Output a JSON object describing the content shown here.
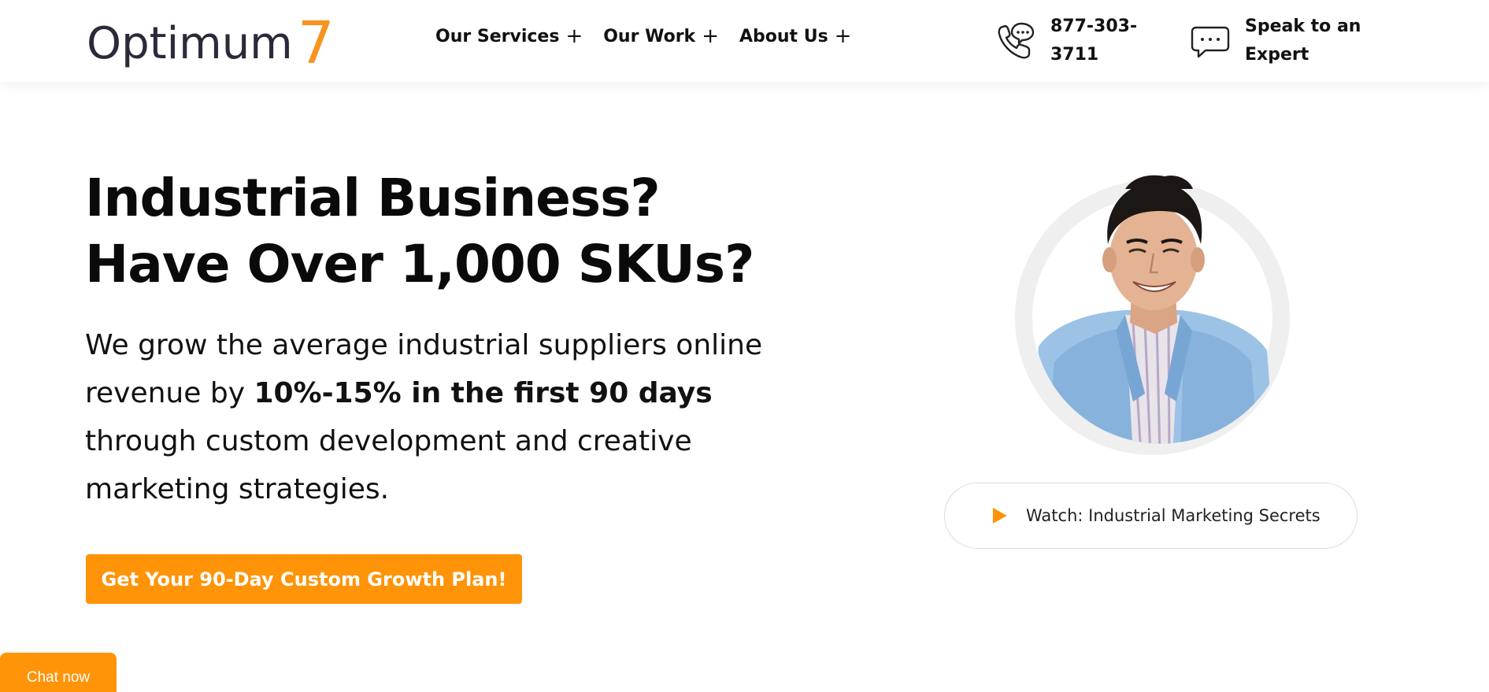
{
  "brand": {
    "logo_word": "Optimum",
    "logo_number": "7",
    "accent_color": "#f7931e",
    "cta_color": "#ff9408"
  },
  "nav": {
    "items": [
      {
        "label": "Our Services",
        "expand": "+"
      },
      {
        "label": "Our Work",
        "expand": "+"
      },
      {
        "label": "About Us",
        "expand": "+"
      }
    ]
  },
  "contact": {
    "phone_line1": "877-303-",
    "phone_line2": "3711",
    "phone_icon": "phone-chat-icon",
    "expert_line1": "Speak to an",
    "expert_line2": "Expert",
    "expert_icon": "chat-bubble-icon"
  },
  "hero": {
    "title_line1": "Industrial Business?",
    "title_line2": "Have Over 1,000 SKUs?",
    "desc_part1": "We grow the average industrial suppliers online revenue by ",
    "desc_bold": "10%-15% in the first 90 days",
    "desc_part2": " through custom development and creative marketing strategies.",
    "cta_label": "Get Your 90-Day Custom Growth Plan!"
  },
  "video": {
    "watch_label": "Watch: Industrial Marketing Secrets",
    "play_icon": "play-icon"
  },
  "chat": {
    "label": "Chat now"
  }
}
